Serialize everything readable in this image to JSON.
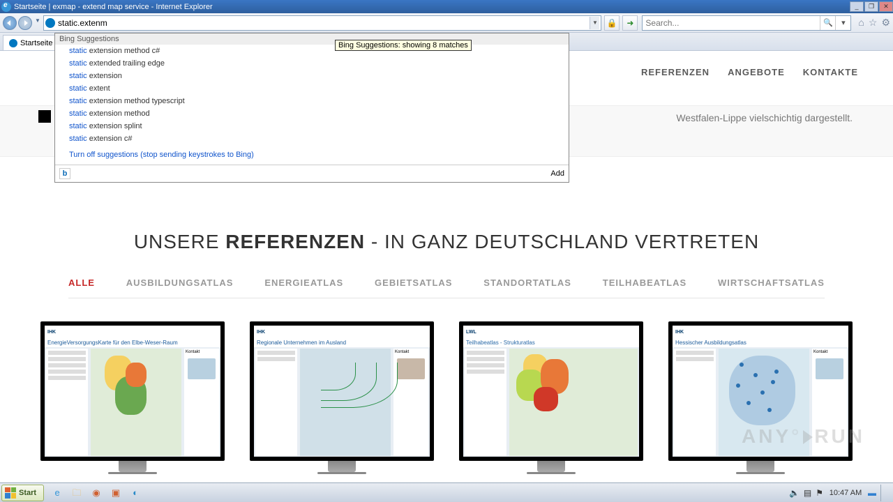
{
  "titlebar": {
    "title": "Startseite | exmap - extend map service - Internet Explorer"
  },
  "nav": {
    "address_value": "static.extenm",
    "search_placeholder": "Search...",
    "tab_label": "Startseite"
  },
  "suggest": {
    "header": "Bing Suggestions",
    "tooltip": "Bing Suggestions: showing 8 matches",
    "keyword": "static",
    "items": [
      " extension method c#",
      " extended trailing edge",
      " extension",
      " extent",
      " extension method typescript",
      " extension method",
      " extension splint",
      " extension c#"
    ],
    "turnoff": "Turn off suggestions (stop sending keystrokes to Bing)",
    "add": "Add"
  },
  "page": {
    "nav_links": [
      "REFERENZEN",
      "ANGEBOTE",
      "KONTAKTE"
    ],
    "subtext": "Westfalen-Lippe vielschichtig dargestellt.",
    "headline_pre": "UNSERE ",
    "headline_bold": "REFERENZEN",
    "headline_post": " - IN GANZ DEUTSCHLAND VERTRETEN",
    "filters": [
      "ALLE",
      "AUSBILDUNGSATLAS",
      "ENERGIEATLAS",
      "GEBIETSATLAS",
      "STANDORTATLAS",
      "TEILHABEATLAS",
      "WIRTSCHAFTSATLAS"
    ],
    "cards": [
      {
        "logo": "IHK",
        "title": "EnergieVersorgungsKarte für den Elbe-Weser-Raum",
        "contact": "Kontakt"
      },
      {
        "logo": "IHK",
        "title": "Regionale Unternehmen im Ausland",
        "contact": "Kontakt"
      },
      {
        "logo": "LWL",
        "title": "Teilhabeatlas - Strukturatlas",
        "contact": ""
      },
      {
        "logo": "IHK",
        "title": "Hessischer Ausbildungsatlas",
        "contact": "Kontakt"
      }
    ]
  },
  "taskbar": {
    "start": "Start",
    "clock": "10:47 AM"
  },
  "watermark": {
    "a": "ANY",
    "b": "RUN"
  }
}
